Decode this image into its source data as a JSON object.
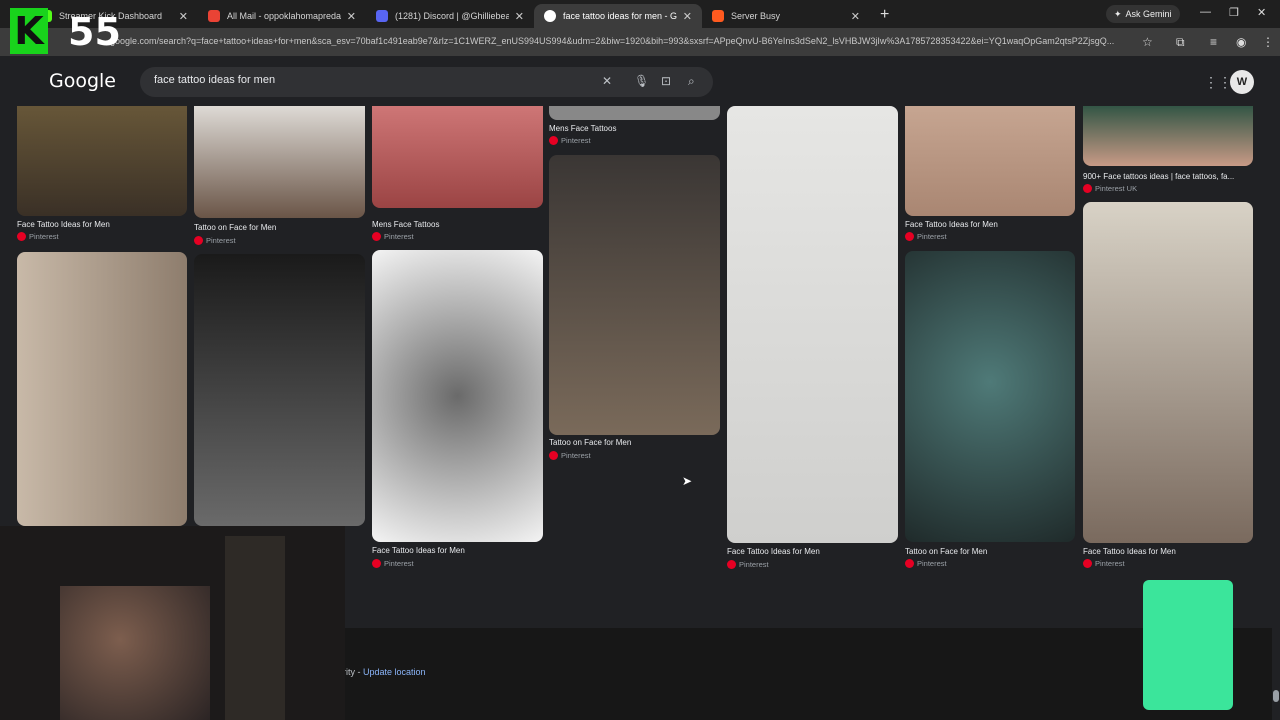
{
  "tabs": [
    {
      "label": "Streamer Kick Dashboard",
      "color": "#53fc18"
    },
    {
      "label": "All Mail - oppoklahomapredato...",
      "color": "#ea4335"
    },
    {
      "label": "(1281) Discord | @Ghilliebear",
      "color": "#5865f2"
    },
    {
      "label": "face tattoo ideas for men - Goo...",
      "color": "#ffffff"
    },
    {
      "label": "Server Busy",
      "color": "#ff5a1f"
    }
  ],
  "ask_gemini": "Ask Gemini",
  "url": "google.com/search?q=face+tattoo+ideas+for+men&sca_esv=70baf1c491eab9e7&rlz=1C1WERZ_enUS994US994&udm=2&biw=1920&bih=993&sxsrf=APpeQnvU-B6YeIns3dSeN2_lsVHBJW3jIw%3A1785728353422&ei=YQ1waqOpGam2qtsP2ZjsgQ...",
  "google_logo": "Google",
  "search_query": "face tattoo ideas for men",
  "results": [
    {
      "caption": "Face Tattoo Ideas for Men",
      "source": "Pinterest"
    },
    {
      "caption": "Tattoo on Face for Men",
      "source": "Pinterest"
    },
    {
      "caption": "Mens Face Tattoos",
      "source": "Pinterest"
    },
    {
      "caption": "Mens Face Tattoos",
      "source": "Pinterest"
    },
    {
      "caption": "Face Tattoo Ideas for Men",
      "source": "Pinterest"
    },
    {
      "caption": "900+ Face tattoos ideas | face tattoos, fa...",
      "source": "Pinterest UK"
    },
    {
      "caption": "Face Tattoo Ideas for Men",
      "source": "Pinterest"
    },
    {
      "caption": "Tattoo on Face for Men",
      "source": "Pinterest"
    },
    {
      "caption": "Face Tattoo Ideas for Men",
      "source": "Pinterest"
    },
    {
      "caption": "Tattoo on Face for Men",
      "source": "Pinterest"
    },
    {
      "caption": "Face Tattoo Ideas for Men",
      "source": "Pinterest"
    }
  ],
  "footer": {
    "prefix": "rity - ",
    "link": "Update location"
  },
  "overlay": {
    "k": "K",
    "number": "55"
  }
}
